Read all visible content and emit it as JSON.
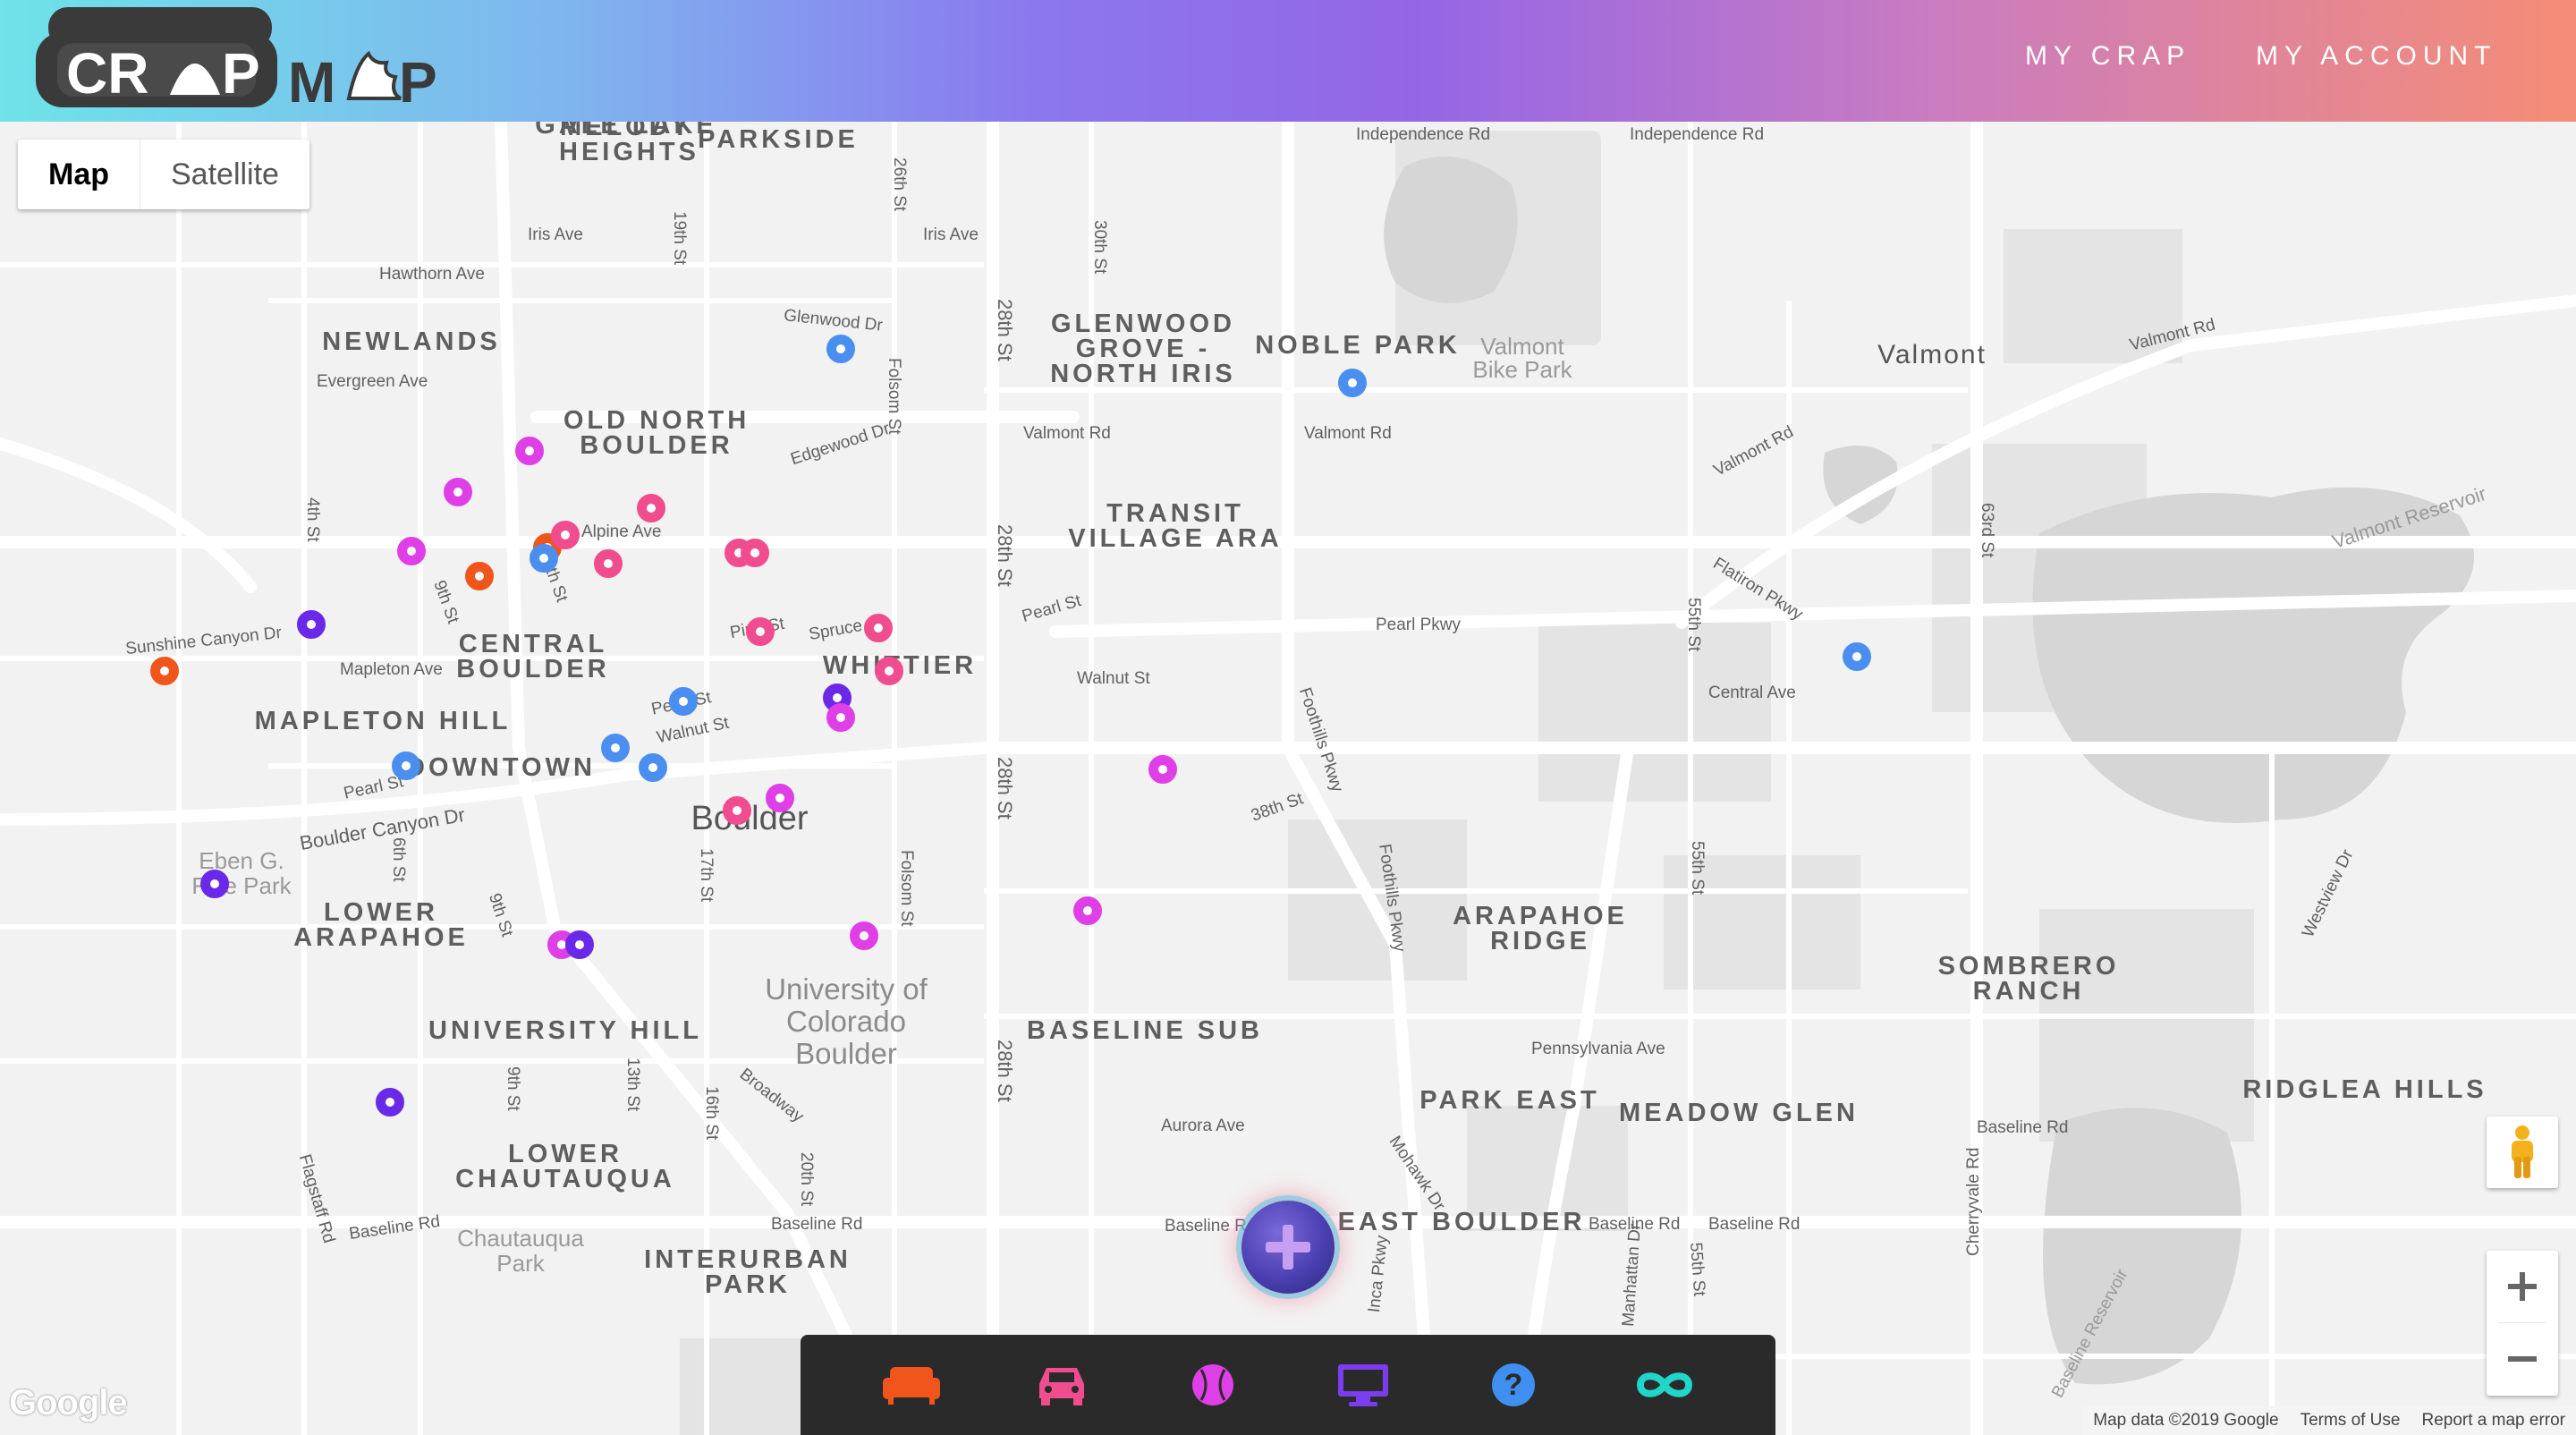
{
  "header": {
    "logo_text": "CRAP MAP",
    "nav": [
      {
        "label": "MY CRAP"
      },
      {
        "label": "MY ACCOUNT"
      }
    ]
  },
  "map_type": {
    "options": [
      "Map",
      "Satellite"
    ],
    "selected": "Map"
  },
  "map_labels": {
    "neighborhoods": [
      "MELODY HEIGHTS",
      "PARKSIDE",
      "NEWLANDS",
      "OLD NORTH BOULDER",
      "GLENWOOD GROVE - NORTH IRIS",
      "NOBLE PARK",
      "TRANSIT VILLAGE ARA",
      "CENTRAL BOULDER",
      "WHITTIER",
      "MAPLETON HILL",
      "DOWNTOWN",
      "LOWER ARAPAHOE",
      "UNIVERSITY HILL",
      "BASELINE SUB",
      "ARAPAHOE RIDGE",
      "SOMBRERO RANCH",
      "PARK EAST",
      "MEADOW GLEN",
      "RIDGLEA HILLS",
      "LOWER CHAUTAUQUA",
      "EAST BOULDER",
      "INTERURBAN PARK",
      "GALE LAKE"
    ],
    "streets": [
      "Independence Rd",
      "Independence Rd",
      "19th St",
      "26th St",
      "Iris Ave",
      "Iris Ave",
      "30th St",
      "Hawthorn Ave",
      "Glenwood Dr",
      "Folsom St",
      "28th St",
      "Valmont Rd",
      "Valmont Rd",
      "Valmont Rd",
      "Valmont Rd",
      "Evergreen Ave",
      "Edgewood Dr",
      "Alpine Ave",
      "4th St",
      "9th St",
      "13th St",
      "28th St",
      "Pearl St",
      "Pearl Pkwy",
      "Flatiron Pkwy",
      "63rd St",
      "55th St",
      "Pine St",
      "Spruce St",
      "Walnut St",
      "Mapleton Ave",
      "Sunshine Canyon Dr",
      "Central Ave",
      "Pearl St",
      "Walnut St",
      "Pearl St",
      "Foothills Pkwy",
      "38th St",
      "28th St",
      "Boulder Canyon Dr",
      "6th St",
      "17th St",
      "9th St",
      "Folsom St",
      "Foothills Pkwy",
      "55th St",
      "Westview Dr",
      "Pennsylvania Ave",
      "9th St",
      "13th St",
      "16th St",
      "Broadway",
      "28th St",
      "Aurora Ave",
      "Mohawk Dr",
      "Baseline Rd",
      "Baseline Rd",
      "Baseline Rd",
      "Baseline Rd",
      "Baseline Rd",
      "Baseline Rd",
      "Flagstaff Rd",
      "20th St",
      "Cherryvale Rd",
      "Manhattan Dr",
      "55th St",
      "Inca Pkwy",
      "Baseline Reservoir",
      "Valmont Reservoir"
    ],
    "city": "Boulder",
    "places": {
      "valmont": "Valmont",
      "university": "University of Colorado Boulder",
      "valmont_park": "Valmont Bike Park",
      "chautauqua": "Chautauqua Park",
      "eben": "Eben G. Fine Park"
    }
  },
  "markers": [
    {
      "category": "blue"
    },
    {
      "category": "blue"
    },
    {
      "category": "magenta"
    },
    {
      "category": "magenta"
    },
    {
      "category": "pink"
    },
    {
      "category": "magenta"
    },
    {
      "category": "orange"
    },
    {
      "category": "blue"
    },
    {
      "category": "pink"
    },
    {
      "category": "pink"
    },
    {
      "category": "pink"
    },
    {
      "category": "pink"
    },
    {
      "category": "orange"
    },
    {
      "category": "purple"
    },
    {
      "category": "orange"
    },
    {
      "category": "pink"
    },
    {
      "category": "pink"
    },
    {
      "category": "pink"
    },
    {
      "category": "purple"
    },
    {
      "category": "magenta"
    },
    {
      "category": "blue"
    },
    {
      "category": "blue"
    },
    {
      "category": "blue"
    },
    {
      "category": "blue"
    },
    {
      "category": "blue"
    },
    {
      "category": "magenta"
    },
    {
      "category": "pink"
    },
    {
      "category": "magenta"
    },
    {
      "category": "purple"
    },
    {
      "category": "magenta"
    },
    {
      "category": "magenta"
    },
    {
      "category": "magenta"
    },
    {
      "category": "purple"
    },
    {
      "category": "purple"
    }
  ],
  "marker_colors": {
    "blue": "#4a8ff0",
    "magenta": "#df3fe6",
    "pink": "#ef4d8e",
    "orange": "#f0561c",
    "purple": "#6a29e8"
  },
  "categories": [
    {
      "name": "furniture",
      "icon": "sofa-icon",
      "color": "#f0561c"
    },
    {
      "name": "vehicles",
      "icon": "car-icon",
      "color": "#ef4d8e"
    },
    {
      "name": "sports",
      "icon": "baseball-icon",
      "color": "#df3fe6"
    },
    {
      "name": "electronics",
      "icon": "monitor-icon",
      "color": "#7c3cf0"
    },
    {
      "name": "misc",
      "icon": "question-icon",
      "color": "#3f8ff0"
    },
    {
      "name": "free",
      "icon": "infinity-icon",
      "color": "#1fd6c9"
    }
  ],
  "footer": {
    "google": "Google",
    "map_data": "Map data ©2019 Google",
    "terms": "Terms of Use",
    "report": "Report a map error"
  }
}
